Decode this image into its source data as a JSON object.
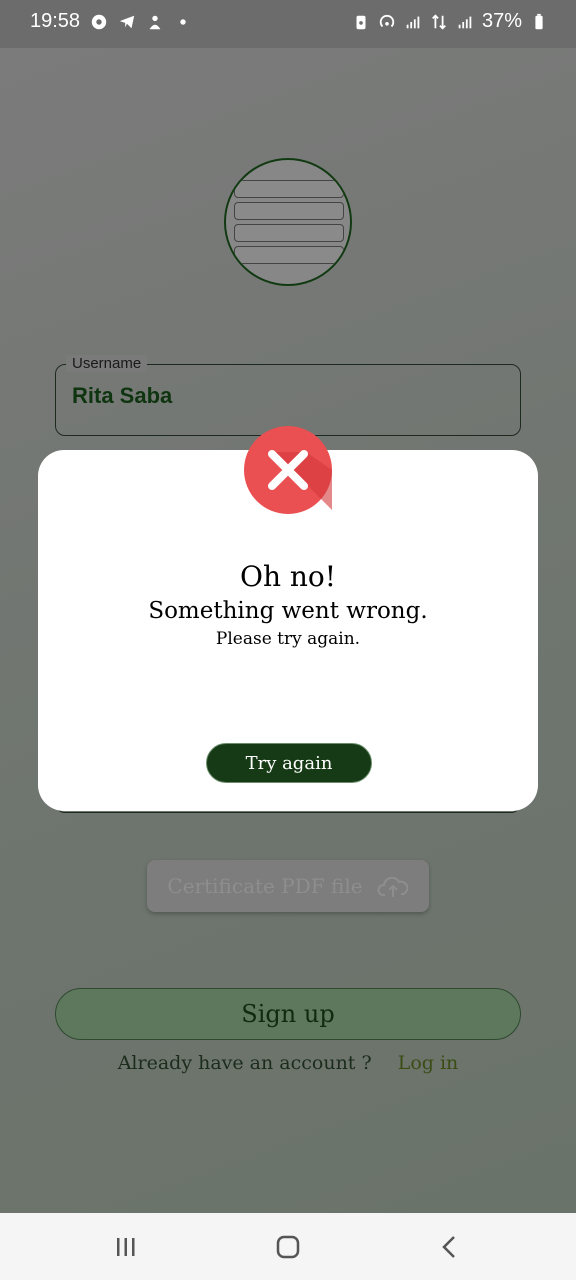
{
  "status_bar": {
    "time": "19:58",
    "battery": "37%",
    "icons_left": [
      "chrome-icon",
      "telegram-icon",
      "app-icon",
      "dot-icon"
    ],
    "icons_right": [
      "battery-saver-icon",
      "hotspot-icon",
      "signal-icon",
      "data-icon",
      "signal-icon",
      "battery-icon"
    ]
  },
  "form": {
    "username_label": "Username",
    "username_value": "Rita Saba",
    "certificate_label": "Certificate PDF file",
    "signup_label": "Sign up",
    "already_text": "Already have an account ?",
    "login_link": "Log in"
  },
  "dialog": {
    "title": "Oh no!",
    "subtitle": "Something went wrong.",
    "hint": "Please try again.",
    "button_label": "Try again",
    "icon": "error-icon",
    "accent": "#163a16",
    "error_color": "#ea4f52"
  },
  "nav": {
    "icons": [
      "recent-apps-icon",
      "home-icon",
      "back-icon"
    ]
  }
}
